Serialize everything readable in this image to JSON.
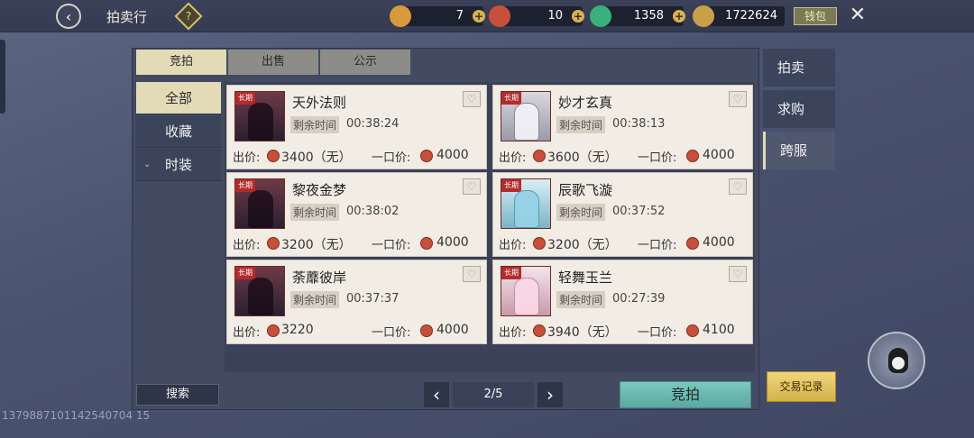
{
  "header": {
    "title": "拍卖行",
    "help_label": "?",
    "wallet_label": "钱包",
    "currencies": [
      {
        "name": "orange-item",
        "value": "7",
        "color": "#d89a3a"
      },
      {
        "name": "red-coin",
        "value": "10",
        "color": "#c8503a"
      },
      {
        "name": "jade",
        "value": "1358",
        "color": "#3ab07a"
      },
      {
        "name": "gold-ingot",
        "value": "1722624",
        "color": "#c8a04a"
      }
    ]
  },
  "tabs": [
    "竞拍",
    "出售",
    "公示"
  ],
  "left_nav": [
    "全部",
    "收藏",
    "时装"
  ],
  "right_nav": [
    "拍卖",
    "求购",
    "跨服"
  ],
  "labels": {
    "remaining": "剩余时间",
    "bid": "出价:",
    "buyout": "一口价:",
    "tag": "长期"
  },
  "items": [
    {
      "name": "天外法则",
      "time": "00:38:24",
      "bid": "3400（无）",
      "buyout": "4000",
      "style": "dark"
    },
    {
      "name": "妙才玄真",
      "time": "00:38:13",
      "bid": "3600（无）",
      "buyout": "4000",
      "style": "light"
    },
    {
      "name": "黎夜金梦",
      "time": "00:38:02",
      "bid": "3200（无）",
      "buyout": "4000",
      "style": "dark"
    },
    {
      "name": "辰歌飞漩",
      "time": "00:37:52",
      "bid": "3200（无）",
      "buyout": "4000",
      "style": "cyan"
    },
    {
      "name": "荼蘼彼岸",
      "time": "00:37:37",
      "bid": "3220",
      "buyout": "4000",
      "style": "dark"
    },
    {
      "name": "轻舞玉兰",
      "time": "00:27:39",
      "bid": "3940（无）",
      "buyout": "4100",
      "style": "pink"
    }
  ],
  "footer": {
    "search_label": "搜索",
    "page": "2/5",
    "bid_label": "竞拍",
    "trade_record_label": "交易记录",
    "id_text": "1379887101142540704 15"
  }
}
